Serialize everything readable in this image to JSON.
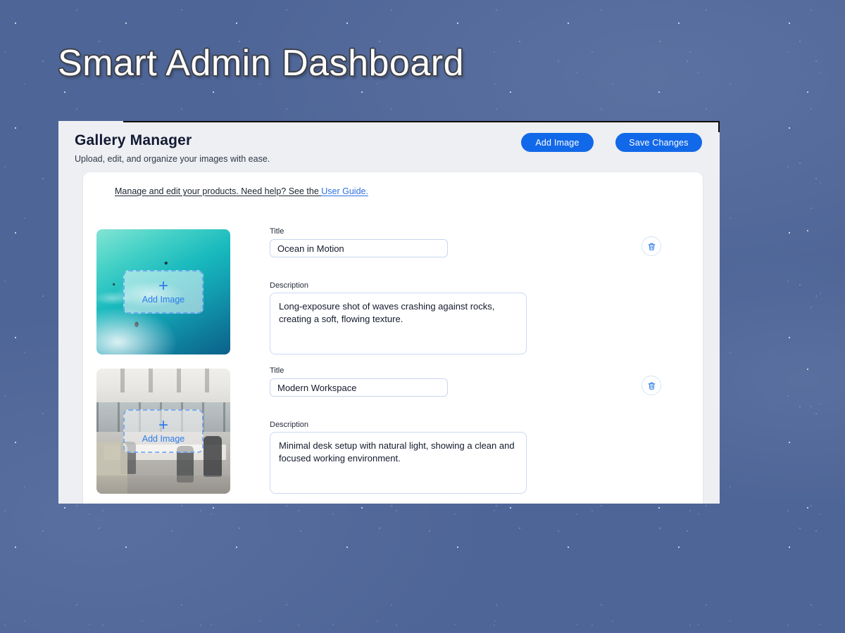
{
  "page": {
    "title": "Smart Admin Dashboard"
  },
  "gallery": {
    "header": {
      "title": "Gallery Manager",
      "subtitle": "Upload, edit, and organize your images with ease."
    },
    "toolbar": {
      "add_image_label": "Add Image",
      "save_changes_label": "Save Changes"
    },
    "help": {
      "text": "Manage and edit your products. Need help? See the ",
      "link_label": "User Guide."
    },
    "rows": [
      {
        "image_name": "ocean-surfers-photo",
        "overlay": {
          "plus": "+",
          "label": "Add Image"
        },
        "title_label": "Title",
        "title_value": "Ocean in Motion",
        "description_label": "Description",
        "description_value": "Long-exposure shot of waves crashing against rocks, creating a soft, flowing texture.",
        "delete_icon": "trash-icon"
      },
      {
        "image_name": "modern-office-photo",
        "overlay": {
          "plus": "+",
          "label": "Add Image"
        },
        "title_label": "Title",
        "title_value": "Modern Workspace",
        "description_label": "Description",
        "description_value": "Minimal desk setup with natural light, showing a clean and focused working environment.",
        "delete_icon": "trash-icon"
      }
    ]
  },
  "colors": {
    "accent_blue": "#1168e8",
    "link_blue": "#2e6fe0",
    "dropzone_blue": "#2e7bea",
    "panel_bg": "#edeff2",
    "sky_blue": "#4e6597"
  }
}
